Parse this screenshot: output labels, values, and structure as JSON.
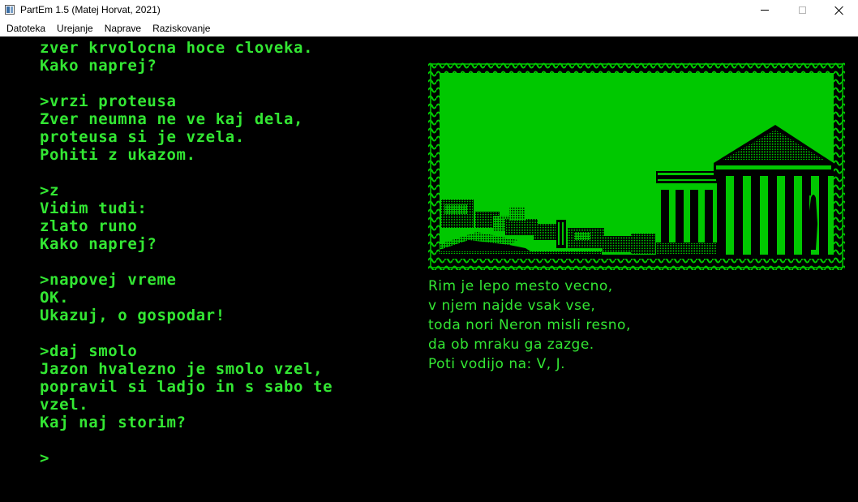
{
  "window": {
    "title": "PartEm 1.5 (Matej Horvat, 2021)"
  },
  "menu": {
    "items": [
      "Datoteka",
      "Urejanje",
      "Naprave",
      "Raziskovanje"
    ]
  },
  "transcript": {
    "lines": [
      "zver krvolocna hoce cloveka.",
      "Kako naprej?",
      "",
      ">vrzi proteusa",
      "Zver neumna ne ve kaj dela,",
      "proteusa si je vzela.",
      "Pohiti z ukazom.",
      "",
      ">z",
      "Vidim tudi:",
      "zlato runo",
      "Kako naprej?",
      "",
      ">napovej vreme",
      "OK.",
      "Ukazuj, o gospodar!",
      "",
      ">daj smolo",
      "Jazon hvalezno je smolo vzel,",
      "popravil si ladjo in s sabo te",
      "vzel.",
      "Kaj naj storim?",
      "",
      ">"
    ]
  },
  "description": {
    "lines": [
      "Rim je lepo mesto vecno,",
      "v njem najde vsak vse,",
      "toda nori Neron misli resno,",
      "da ob mraku ga zazge.",
      "Poti vodijo na: V, J."
    ]
  },
  "colors": {
    "screen_bg": "#000000",
    "phosphor_green": "#33e733",
    "picture_green": "#00c800"
  },
  "picture": {
    "icon": "rome-temple-scene"
  }
}
